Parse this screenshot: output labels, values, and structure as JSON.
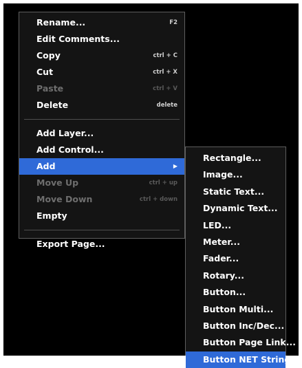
{
  "main_menu": {
    "items": [
      {
        "label": "Rename...",
        "shortcut": "F2"
      },
      {
        "label": "Edit Comments...",
        "shortcut": ""
      },
      {
        "label": "Copy",
        "shortcut": "ctrl + C"
      },
      {
        "label": "Cut",
        "shortcut": "ctrl + X"
      },
      {
        "label": "Paste",
        "shortcut": "ctrl + V",
        "disabled": true
      },
      {
        "label": "Delete",
        "shortcut": "delete"
      },
      {
        "label": "Add Layer...",
        "shortcut": ""
      },
      {
        "label": "Add Control...",
        "shortcut": ""
      },
      {
        "label": "Add",
        "submenu_arrow": "▶",
        "highlighted": true
      },
      {
        "label": "Move Up",
        "shortcut": "ctrl + up",
        "disabled": true
      },
      {
        "label": "Move Down",
        "shortcut": "ctrl + down",
        "disabled": true
      },
      {
        "label": "Empty",
        "shortcut": ""
      },
      {
        "label": "Export Page...",
        "shortcut": ""
      }
    ]
  },
  "add_submenu": {
    "items": [
      {
        "label": "Rectangle..."
      },
      {
        "label": "Image..."
      },
      {
        "label": "Static Text..."
      },
      {
        "label": "Dynamic Text..."
      },
      {
        "label": "LED..."
      },
      {
        "label": "Meter..."
      },
      {
        "label": "Fader..."
      },
      {
        "label": "Rotary..."
      },
      {
        "label": "Button..."
      },
      {
        "label": "Button Multi..."
      },
      {
        "label": "Button Inc/Dec..."
      },
      {
        "label": "Button Page Link..."
      },
      {
        "label": "Button NET String...",
        "highlighted": true
      }
    ]
  },
  "colors": {
    "menu_background": "#141414",
    "highlight": "#2f6ad8",
    "disabled_text": "#6e6e6e"
  }
}
